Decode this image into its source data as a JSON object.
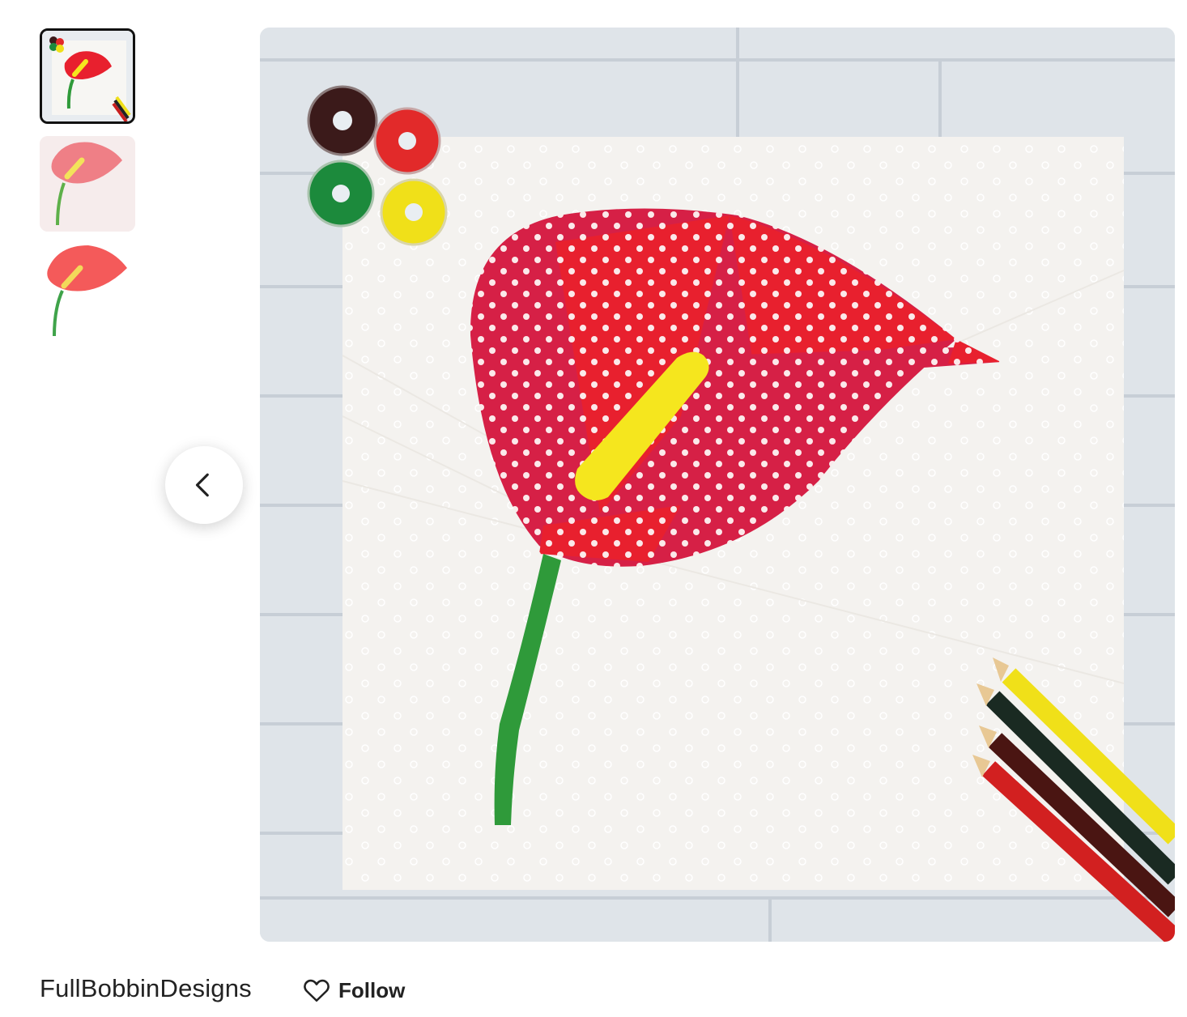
{
  "gallery": {
    "thumbnails": [
      {
        "icon": "quilt-block-photo",
        "selected": true
      },
      {
        "icon": "anthurium-pattern-pink",
        "selected": false
      },
      {
        "icon": "anthurium-pattern-coral",
        "selected": false
      }
    ],
    "prev_icon": "chevron-left-icon"
  },
  "shop": {
    "name": "FullBobbinDesigns",
    "follow_label": "Follow",
    "follow_icon": "heart-outline-icon"
  },
  "colors": {
    "spathe_red": "#e8202e",
    "spathe_dark": "#d62046",
    "spadix_yellow": "#f5e61e",
    "stem_green": "#2f9a3a",
    "background_fabric": "#f4f2ef",
    "wood_planks": "#dfe4e9"
  }
}
